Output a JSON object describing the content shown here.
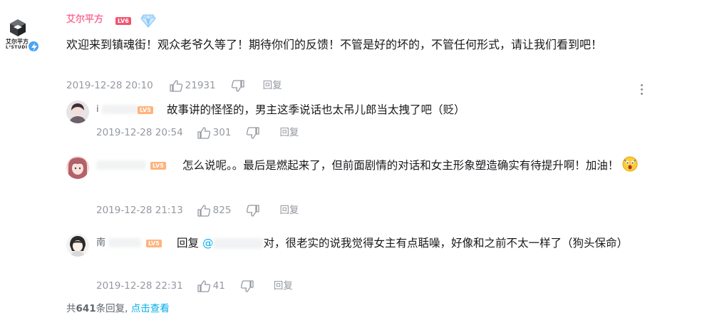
{
  "main_comment": {
    "avatar_brand": {
      "line1": "艾尔平方",
      "line2": "L²STUDIO"
    },
    "username": "艾尔平方",
    "level": "LV6",
    "text": "欢迎来到镇魂街！观众老爷久等了！期待你们的反馈！不管是好的坏的，不管任何形式，请让我们看到吧！",
    "timestamp": "2019-12-28 20:10",
    "likes": "21931",
    "reply_label": "回复",
    "more_icon": "more-vertical-icon"
  },
  "replies": [
    {
      "username_visible": "i",
      "level": "LV5",
      "text": "故事讲的怪怪的，男主这季说话也太吊儿郎当太拽了吧（贬）",
      "timestamp": "2019-12-28 20:54",
      "likes": "301",
      "reply_label": "回复"
    },
    {
      "username_visible": "",
      "level": "LV5",
      "text": "怎么说呢。。最后是燃起来了，但前面剧情的对话和女主形象塑造确实有待提升啊！加油！",
      "timestamp": "2019-12-28 21:13",
      "likes": "825",
      "reply_label": "回复"
    },
    {
      "username_visible": "南",
      "level": "LV5",
      "reply_prefix": "回复",
      "mention": "@",
      "text": "对，很老实的说我觉得女主有点聒噪，好像和之前不太一样了（狗头保命）",
      "timestamp": "2019-12-28 22:31",
      "likes": "41",
      "reply_label": "回复"
    }
  ],
  "footer": {
    "prefix": "共",
    "count": "641",
    "suffix": "条回复,",
    "link": "点击查看"
  },
  "colors": {
    "username_pink": "#fb7299",
    "meta_gray": "#9499a0",
    "link_blue": "#00aeec",
    "level_red": "#f0556f",
    "level_orange": "#ffb37c"
  }
}
